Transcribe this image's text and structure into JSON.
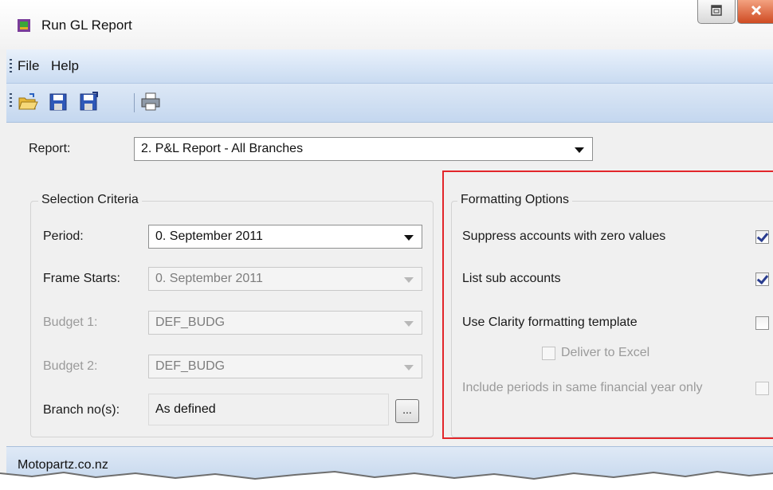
{
  "window": {
    "title": "Run GL Report"
  },
  "menu": {
    "file": "File",
    "help": "Help"
  },
  "toolbar": {
    "icons": [
      "open-folder-icon",
      "save-icon",
      "save-as-icon",
      "print-icon"
    ]
  },
  "report": {
    "label": "Report:",
    "value": "2. P&L Report - All Branches"
  },
  "selection": {
    "caption": "Selection Criteria",
    "period_label": "Period:",
    "period_value": "0. September 2011",
    "frame_label": "Frame Starts:",
    "frame_value": "0. September 2011",
    "budget1_label": "Budget 1:",
    "budget1_value": "DEF_BUDG",
    "budget2_label": "Budget 2:",
    "budget2_value": "DEF_BUDG",
    "branch_label": "Branch no(s):",
    "branch_value": "As defined",
    "branch_button": "..."
  },
  "formatting": {
    "caption": "Formatting Options",
    "suppress_label": "Suppress accounts with zero values",
    "suppress_checked": true,
    "list_sub_label": "List sub accounts",
    "list_sub_checked": true,
    "clarity_label": "Use Clarity formatting template",
    "clarity_checked": false,
    "excel_label": "Deliver to Excel",
    "excel_checked": false,
    "periods_label": "Include periods in same financial year only",
    "periods_checked": false
  },
  "status": {
    "text": "Motopartz.co.nz"
  },
  "colors": {
    "highlight": "#e2262b",
    "menubar": "#c9dbf1",
    "window_bg": "#f0f0f0"
  }
}
